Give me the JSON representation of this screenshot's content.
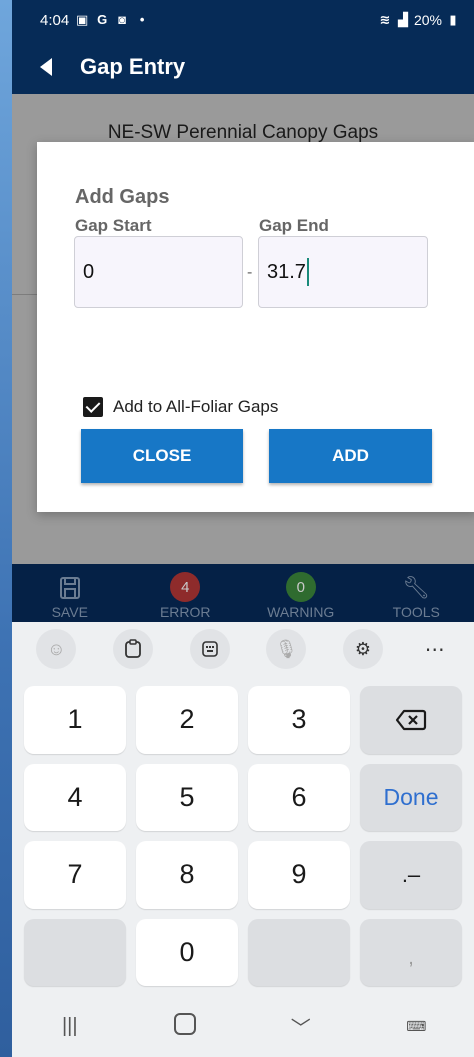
{
  "status_bar": {
    "time": "4:04",
    "battery": "20%"
  },
  "header": {
    "title": "Gap Entry"
  },
  "content": {
    "section_title": "NE-SW Perennial Canopy Gaps"
  },
  "dialog": {
    "title": "Add Gaps",
    "gap_start_label": "Gap Start",
    "gap_end_label": "Gap End",
    "gap_start_value": "0",
    "gap_end_value": "31.7",
    "separator": "-",
    "checkbox_label": "Add to All-Foliar Gaps",
    "checkbox_checked": true,
    "close_label": "CLOSE",
    "add_label": "ADD"
  },
  "toolbar": {
    "save_label": "SAVE",
    "error_label": "ERROR",
    "error_count": "4",
    "warning_label": "WARNING",
    "warning_count": "0",
    "tools_label": "TOOLS"
  },
  "keyboard": {
    "keys": [
      "1",
      "2",
      "3",
      "4",
      "5",
      "6",
      "7",
      "8",
      "9",
      "0"
    ],
    "done_label": "Done",
    "dot_dash_label": ".–",
    "comma_label": ","
  },
  "colors": {
    "header_bg": "#062b57",
    "primary_button": "#1777c6",
    "done_text": "#2f6fcf"
  }
}
